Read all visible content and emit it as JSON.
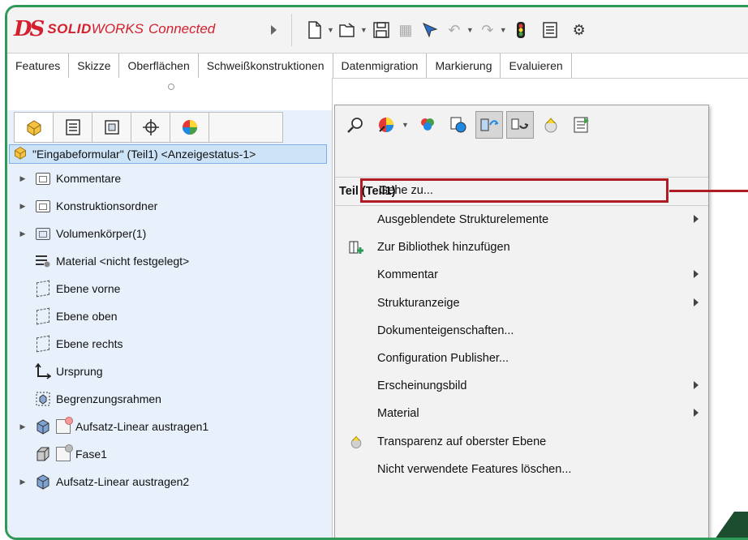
{
  "app": {
    "logo_ds": "DS",
    "logo_solid": "SOLID",
    "logo_works": "WORKS",
    "logo_connected": "Connected"
  },
  "quick_access": {
    "icons": [
      "new-document-icon",
      "open-folder-icon",
      "save-icon",
      "print-icon",
      "select-icon",
      "undo-icon",
      "redo-icon",
      "traffic-light-icon",
      "properties-icon",
      "options-gear-icon"
    ]
  },
  "ribbon_tabs": [
    "Features",
    "Skizze",
    "Oberflächen",
    "Schweißkonstruktionen",
    "Datenmigration",
    "Markierung",
    "Evaluieren"
  ],
  "panel_tabs": [
    "feature-manager-icon",
    "property-manager-icon",
    "configuration-manager-icon",
    "dimxpert-icon",
    "display-manager-icon"
  ],
  "tree": {
    "root": "\"Eingabeformular\" (Teil1) <Anzeigestatus-1>",
    "nodes": [
      {
        "label": "Kommentare",
        "expandable": true,
        "icon": "folder-icon"
      },
      {
        "label": "Konstruktionsordner",
        "expandable": true,
        "icon": "folder-icon"
      },
      {
        "label": "Volumenkörper(1)",
        "expandable": true,
        "icon": "solid-bodies-folder-icon"
      },
      {
        "label": "Material <nicht festgelegt>",
        "expandable": false,
        "icon": "material-icon"
      },
      {
        "label": "Ebene vorne",
        "expandable": false,
        "icon": "plane-icon"
      },
      {
        "label": "Ebene oben",
        "expandable": false,
        "icon": "plane-icon"
      },
      {
        "label": "Ebene rechts",
        "expandable": false,
        "icon": "plane-icon"
      },
      {
        "label": "Ursprung",
        "expandable": false,
        "icon": "origin-icon"
      },
      {
        "label": "Begrenzungsrahmen",
        "expandable": false,
        "icon": "bounding-box-icon"
      },
      {
        "label": "Aufsatz-Linear austragen1",
        "expandable": true,
        "icon": "extrude-icon"
      },
      {
        "label": "Fase1",
        "expandable": false,
        "icon": "chamfer-icon"
      },
      {
        "label": "Aufsatz-Linear austragen2",
        "expandable": true,
        "icon": "extrude-icon"
      }
    ]
  },
  "context_menu": {
    "toolbar_icons": [
      "zoom-to-selection-icon",
      "appearance-icon",
      "edit-color-icon",
      "hide-show-icon",
      "isolate-icon",
      "view-orientation-icon",
      "transparency-icon",
      "properties-icon"
    ],
    "goto": "Gehe zu...",
    "section_header": "Teil (Teil1)",
    "items": [
      {
        "label": "Ausgeblendete Strukturelemente",
        "submenu": true,
        "icon": ""
      },
      {
        "label": "Zur Bibliothek hinzufügen",
        "submenu": false,
        "icon": "add-to-library-icon"
      },
      {
        "label": "Kommentar",
        "submenu": true,
        "icon": ""
      },
      {
        "label": "Strukturanzeige",
        "submenu": true,
        "icon": ""
      },
      {
        "label": "Dokumenteigenschaften...",
        "submenu": false,
        "icon": ""
      },
      {
        "label": "Configuration Publisher...",
        "submenu": false,
        "icon": ""
      },
      {
        "label": "Erscheinungsbild",
        "submenu": true,
        "icon": ""
      },
      {
        "label": "Material",
        "submenu": true,
        "icon": ""
      },
      {
        "label": "Transparenz auf oberster Ebene",
        "submenu": false,
        "icon": "transparency-icon"
      },
      {
        "label": "Nicht verwendete Features löschen...",
        "submenu": false,
        "icon": ""
      }
    ]
  },
  "colors": {
    "frame": "#2e9a57",
    "highlight": "#b01c24",
    "brand": "#d31f2e"
  }
}
